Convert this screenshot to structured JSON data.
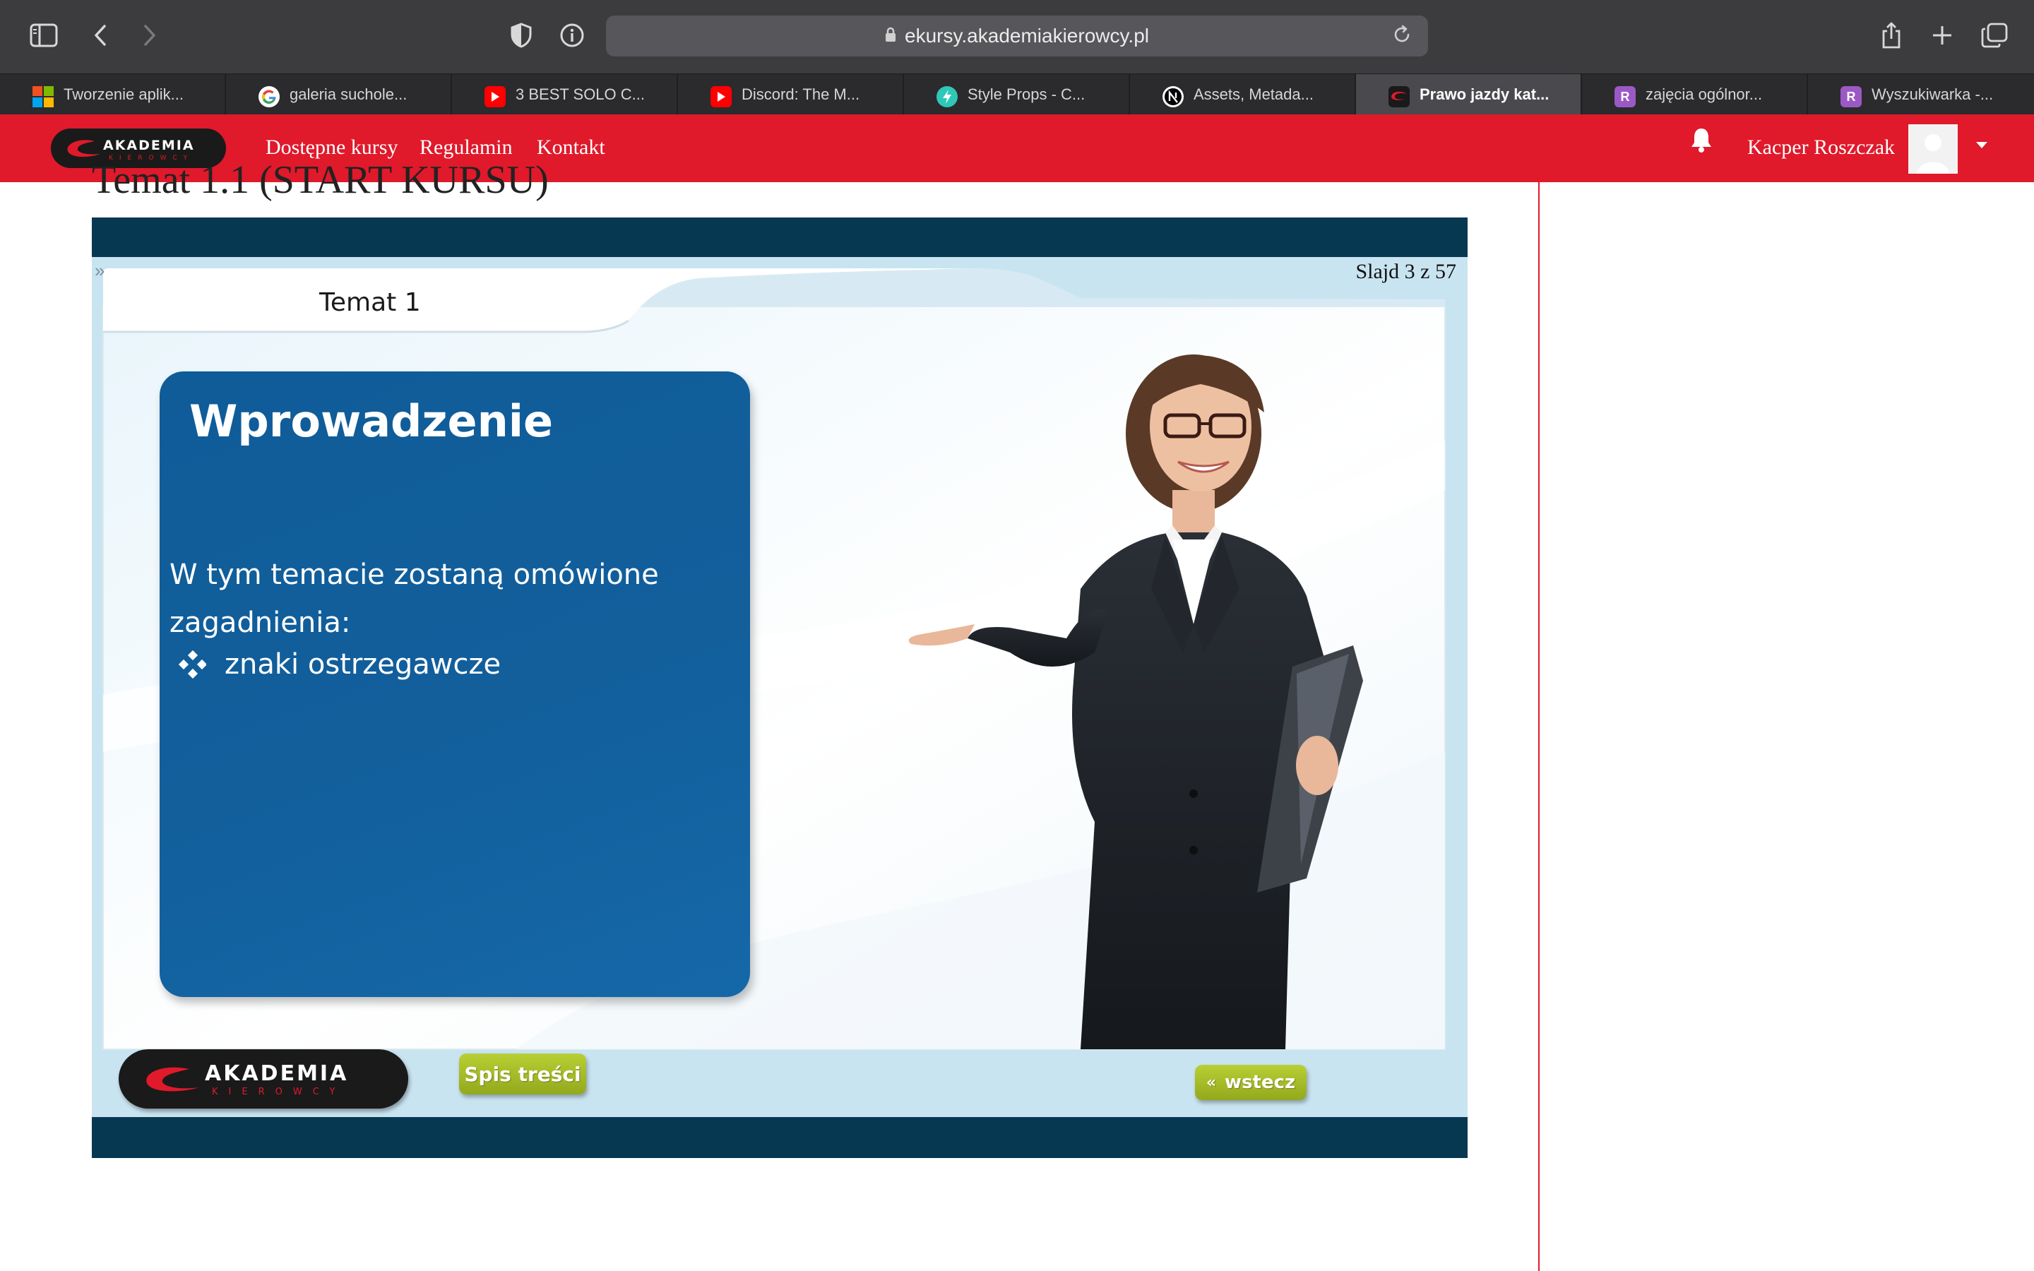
{
  "browser": {
    "url": "ekursy.akademiakierowcy.pl",
    "tabs": [
      {
        "label": "Tworzenie aplik...",
        "icon": "microsoft-icon",
        "active": false
      },
      {
        "label": "galeria suchole...",
        "icon": "google-icon",
        "active": false
      },
      {
        "label": "3 BEST SOLO C...",
        "icon": "youtube-icon",
        "active": false
      },
      {
        "label": "Discord: The M...",
        "icon": "youtube-icon",
        "active": false
      },
      {
        "label": "Style Props - C...",
        "icon": "chakra-icon",
        "active": false
      },
      {
        "label": "Assets, Metada...",
        "icon": "nextjs-icon",
        "active": false
      },
      {
        "label": "Prawo jazdy kat...",
        "icon": "akademia-icon",
        "active": true
      },
      {
        "label": "zajęcia ogólnor...",
        "icon": "r-icon",
        "active": false
      },
      {
        "label": "Wyszukiwarka -...",
        "icon": "r-icon",
        "active": false
      }
    ]
  },
  "navbar": {
    "brand": "AKADEMIA",
    "brand_sub": "KIEROWCY",
    "links": [
      "Dostępne kursy",
      "Regulamin",
      "Kontakt"
    ],
    "user_name": "Kacper Roszczak",
    "accent_color": "#e0192b"
  },
  "page": {
    "title": "Temat 1.1 (START KURSU)"
  },
  "slide": {
    "counter": "Slajd 3 z 57",
    "tab_title": "Temat 1",
    "card_title": "Wprowadzenie",
    "card_text": "W tym temacie zostaną omówione zagadnienia:",
    "bullet": "znaki ostrzegawcze",
    "btn_toc": "Spis treści",
    "btn_back_arrow": "«",
    "btn_back": "wstecz",
    "logo_text": "AKADEMIA",
    "logo_sub": "KIEROWCY"
  }
}
